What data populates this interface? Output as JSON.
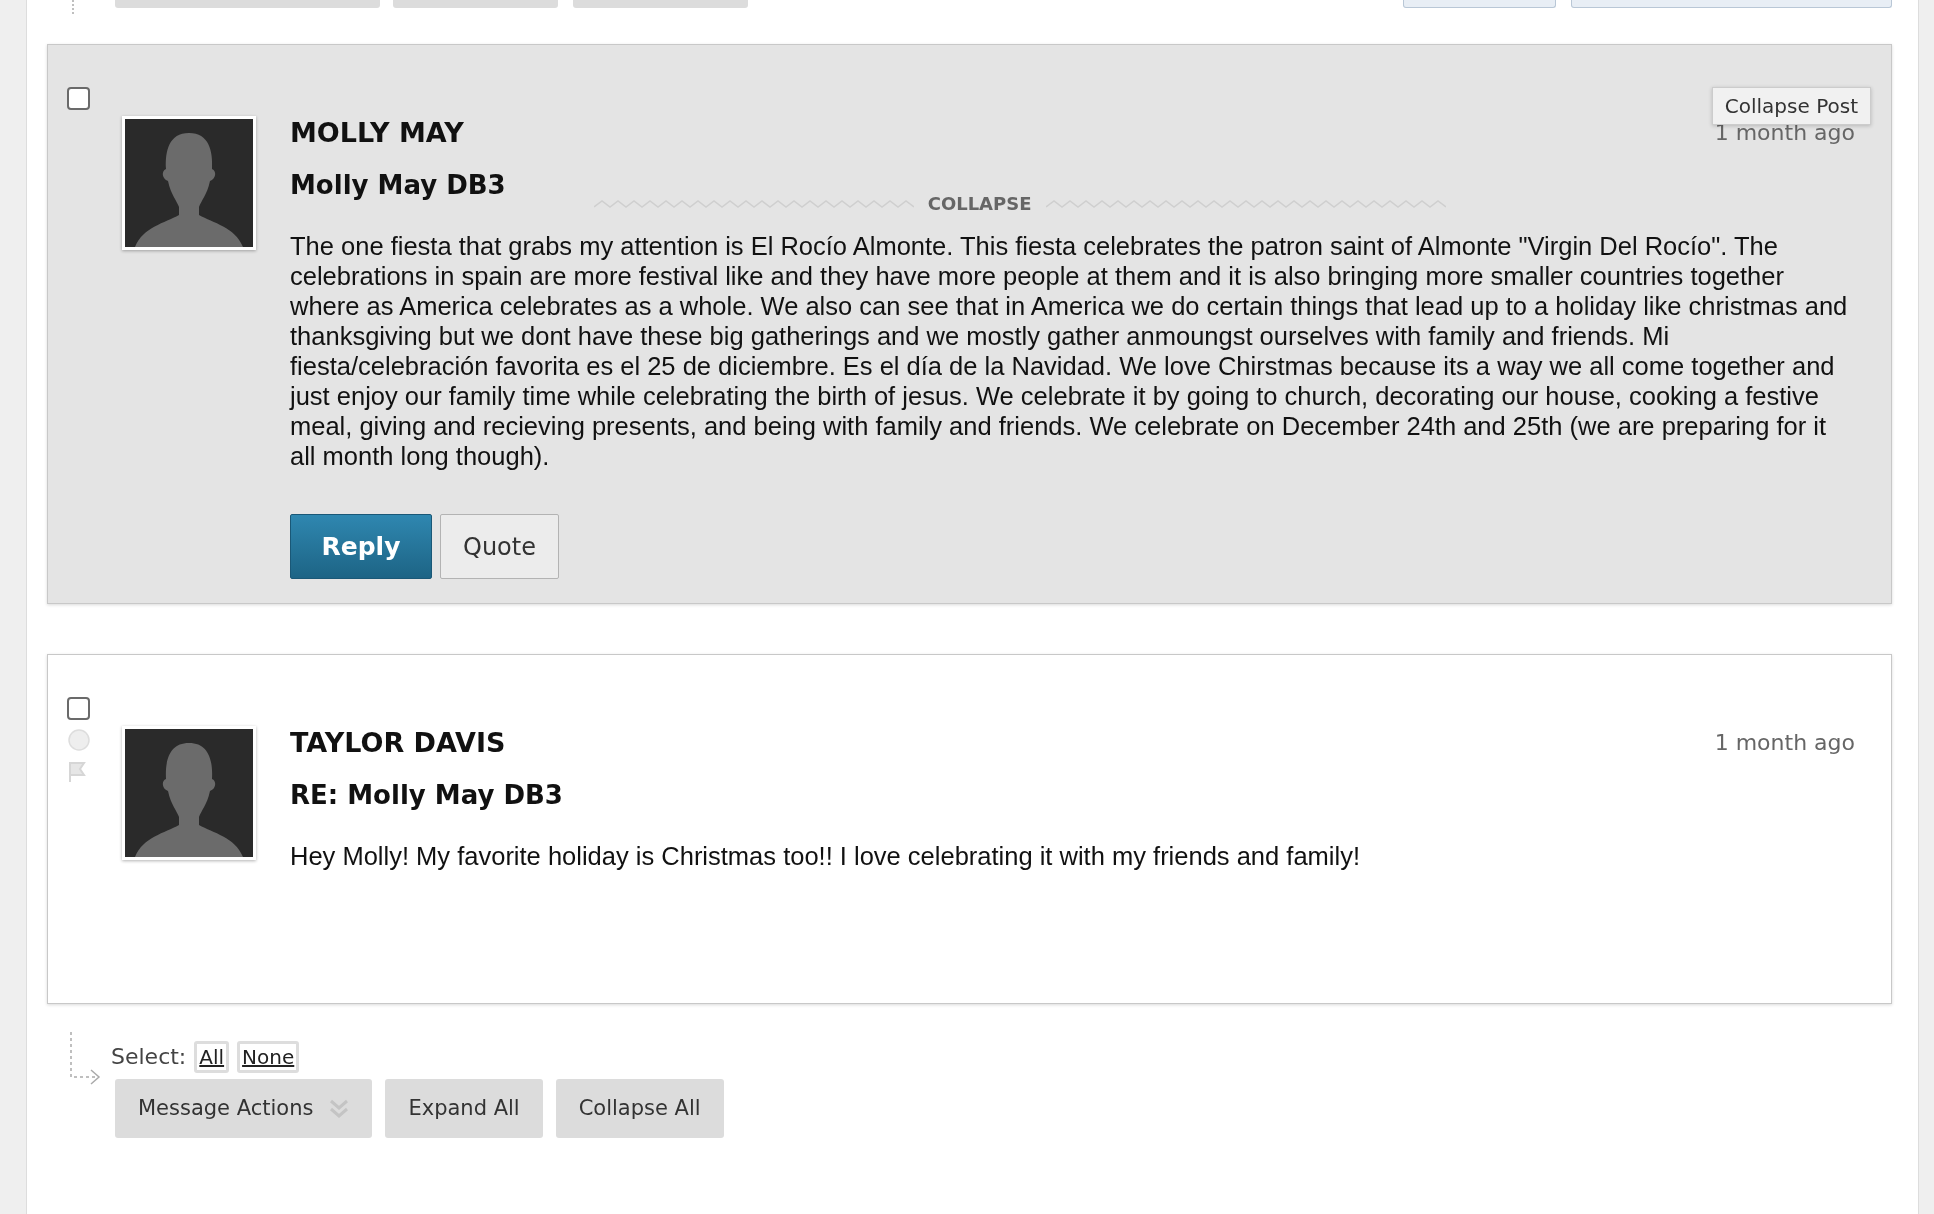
{
  "posts": [
    {
      "author": "MOLLY MAY",
      "subject": "Molly May DB3",
      "time": "1 month ago",
      "checked": false,
      "hovered": true,
      "tooltip": "Collapse Post",
      "collapse_label": "COLLAPSE",
      "body": "The one fiesta that grabs my attention is El Rocío Almonte. This fiesta celebrates the patron saint of Almonte \"Virgin Del Rocío\". The celebrations in spain are more festival like and they have more people at them and it is also bringing more smaller countries together where as America celebrates as a whole. We also can see that in America we do certain things that lead up to a holiday like christmas and thanksgiving but we dont have these big gatherings and we mostly gather anmoungst ourselves with family and friends. Mi fiesta/celebración favorita es el 25 de diciembre. Es el día de la Navidad. We love Chirstmas because its a way we all come together and just enjoy our family time while celebrating the birth of jesus. We celebrate it by going to church, decorating our house, cooking a festive meal, giving and recieving presents, and being with family and friends. We celebrate on December 24th and 25th (we are preparing for it all month long though).",
      "buttons": [
        {
          "label": "Reply",
          "kind": "primary"
        },
        {
          "label": "Quote",
          "kind": "secondary"
        }
      ]
    },
    {
      "author": "TAYLOR DAVIS",
      "subject": "RE: Molly May DB3",
      "time": "1 month ago",
      "checked": false,
      "hovered": false,
      "flagged": false,
      "body": "Hey Molly! My favorite holiday is Christmas too!! I love celebrating it with my friends and family!"
    }
  ],
  "selection": {
    "label": "Select:",
    "links": [
      "All",
      "None"
    ]
  },
  "toolbar": {
    "buttons": [
      {
        "label": "Message Actions",
        "kind": "dropdown"
      },
      {
        "label": "Expand All",
        "kind": "plain"
      },
      {
        "label": "Collapse All",
        "kind": "plain"
      }
    ]
  }
}
